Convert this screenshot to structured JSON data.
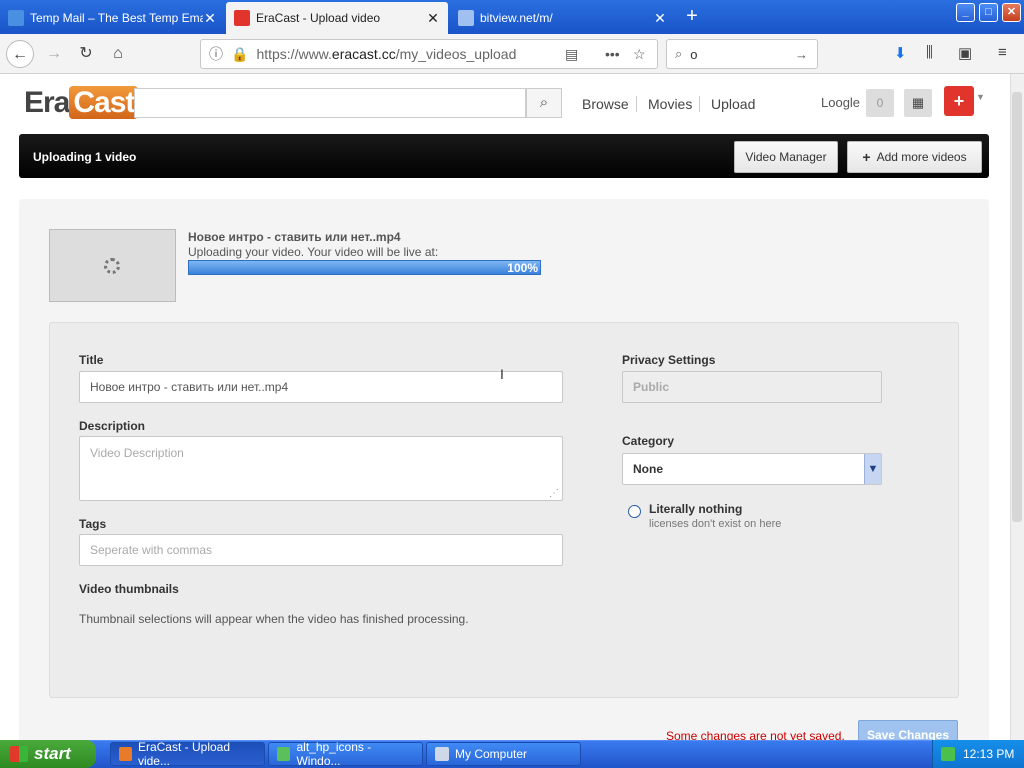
{
  "browser": {
    "tabs": [
      {
        "label": "Temp Mail – The Best Temp Email S",
        "favicon_color": "#4a90e2"
      },
      {
        "label": "EraCast - Upload video",
        "favicon_color": "#e0342d"
      },
      {
        "label": "bitview.net/m/",
        "favicon_color": "#2a6fe0"
      }
    ],
    "url": {
      "scheme_host_prefix": "https://www.",
      "host": "eracast.cc",
      "path": "/my_videos_upload"
    },
    "search_value": "o"
  },
  "site": {
    "logo": {
      "part1": "Era",
      "part2": "Cast"
    },
    "nav": [
      "Browse",
      "Movies",
      "Upload"
    ],
    "user": "Loogle",
    "notifications": "0"
  },
  "bar": {
    "title": "Uploading 1 video",
    "video_manager": "Video Manager",
    "add_more": "Add more videos"
  },
  "upload": {
    "filename": "Новое интро - ставить или нет..mp4",
    "status": "Uploading your video. Your video will be live at:",
    "progress_text": "100%",
    "progress": 1.0
  },
  "form": {
    "title_label": "Title",
    "title_value": "Новое интро - ставить или нет..mp4",
    "description_label": "Description",
    "description_placeholder": "Video Description",
    "tags_label": "Tags",
    "tags_placeholder": "Seperate with commas",
    "thumbnails_label": "Video thumbnails",
    "thumbnails_note": "Thumbnail selections will appear when the video has finished processing.",
    "privacy_label": "Privacy Settings",
    "privacy_value": "Public",
    "category_label": "Category",
    "category_value": "None",
    "license_title": "Literally nothing",
    "license_sub": "licenses don't exist on here",
    "unsaved": "Some changes are not yet saved.",
    "save": "Save Changes"
  },
  "taskbar": {
    "start": "start",
    "items": [
      "EraCast - Upload vide...",
      "alt_hp_icons - Windo...",
      "My Computer"
    ],
    "clock": "12:13 PM"
  }
}
